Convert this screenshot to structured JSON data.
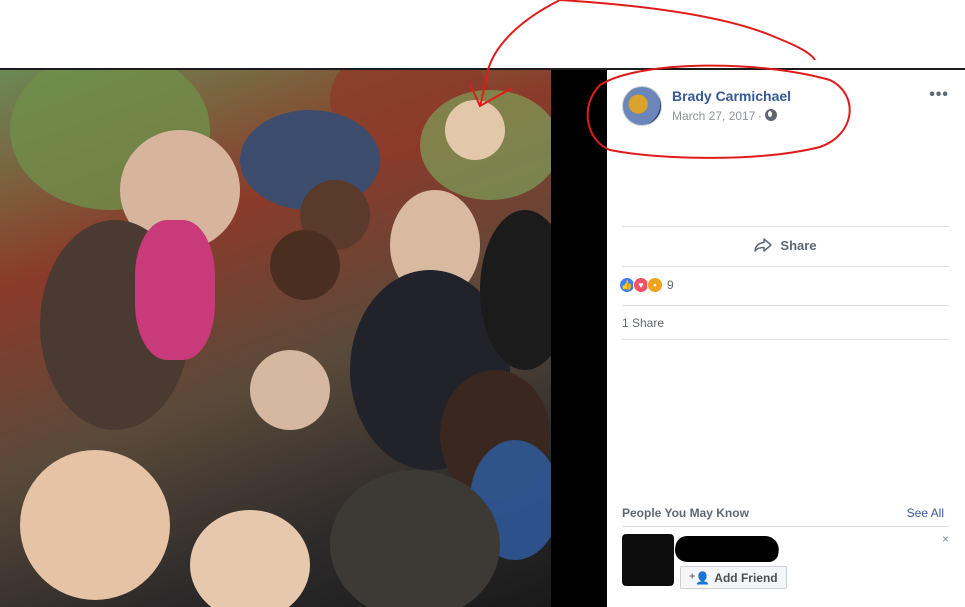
{
  "post": {
    "author_name": "Brady Carmichael",
    "date": "March 27, 2017",
    "more_icon": "more-options-icon",
    "privacy_icon": "globe-icon"
  },
  "actions": {
    "share_label": "Share"
  },
  "reactions": {
    "icons": [
      "like-icon",
      "love-icon",
      "angry-icon"
    ],
    "count": "9"
  },
  "shares": {
    "label": "1 Share"
  },
  "pymk": {
    "title": "People You May Know",
    "see_all": "See All",
    "close": "×",
    "add_friend_label": "Add Friend"
  },
  "colors": {
    "link_blue": "#365899",
    "annotation_red": "#e01b1b"
  }
}
